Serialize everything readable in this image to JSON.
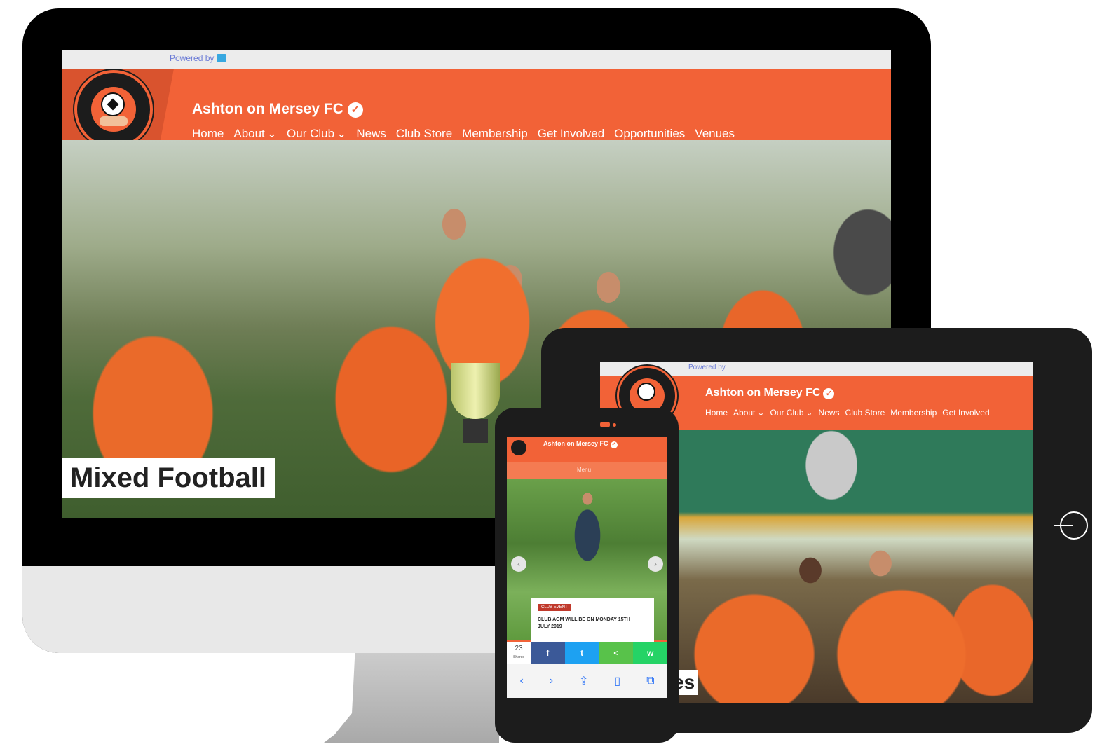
{
  "site": {
    "powered_by": "Powered by",
    "club_name": "Ashton on Mersey FC",
    "verified_icon": "check-circle-icon",
    "colors": {
      "brand": "#f26237",
      "dark": "#1c1c1c",
      "text": "#ffffff"
    }
  },
  "desktop": {
    "nav": [
      "Home",
      "About",
      "Our Club",
      "News",
      "Club Store",
      "Membership",
      "Get Involved",
      "Opportunities",
      "Venues"
    ],
    "hero_label": "Mixed Football"
  },
  "tablet": {
    "nav": [
      "Home",
      "About",
      "Our Club",
      "News",
      "Club Store",
      "Membership",
      "Get Involved"
    ],
    "hero_label": "es"
  },
  "phone": {
    "menu_label": "Menu",
    "news_tag": "CLUB EVENT",
    "news_headline": "CLUB AGM WILL BE ON MONDAY 15TH JULY 2019",
    "share_count": "23",
    "share_label": "Shares",
    "share_buttons": [
      "f",
      "t",
      "<",
      "w"
    ]
  }
}
